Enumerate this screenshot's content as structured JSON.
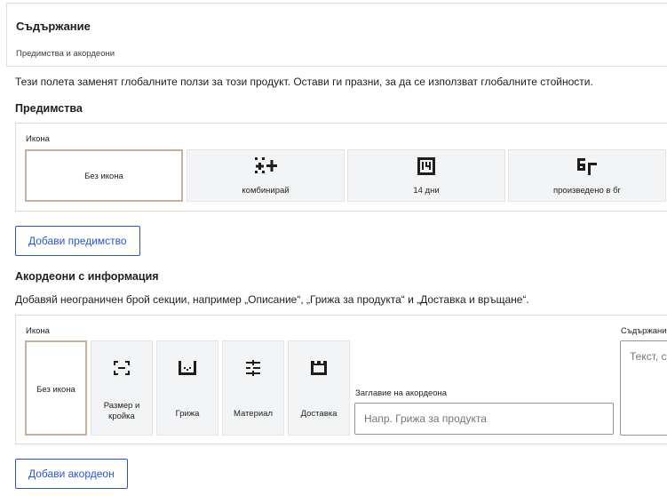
{
  "panel": {
    "title": "Съдържание",
    "subtitle": "Предимства и акордеони"
  },
  "intro": "Тези полета заменят глобалните ползи за този продукт. Остави ги празни, за да се използват глобалните стойности.",
  "benefits": {
    "title": "Предимства",
    "icon_label": "Икона",
    "options": [
      {
        "label": "Без икона",
        "icon": "none",
        "selected": true
      },
      {
        "label": "комбинирай",
        "icon": "combine-icon",
        "selected": false
      },
      {
        "label": "14 дни",
        "icon": "14-days-icon",
        "selected": false
      },
      {
        "label": "произведено в бг",
        "icon": "made-in-bg-icon",
        "selected": false
      }
    ],
    "add_button": "Добави предимство"
  },
  "accordions": {
    "title": "Акордеони с информация",
    "description": "Добавяй неограничен брой секции, например „Описание“, „Грижа за продукта“ и „Доставка и връщане“.",
    "icon_label": "Икона",
    "options": [
      {
        "label": "Без икона",
        "icon": "none",
        "selected": true
      },
      {
        "label": "Размер и кройка",
        "icon": "size-fit-icon",
        "selected": false
      },
      {
        "label": "Грижа",
        "icon": "care-icon",
        "selected": false
      },
      {
        "label": "Материал",
        "icon": "material-icon",
        "selected": false
      },
      {
        "label": "Доставка",
        "icon": "delivery-icon",
        "selected": false
      }
    ],
    "title_field_label": "Заглавие на акордеона",
    "title_field_placeholder": "Напр. Грижа за продукта",
    "content_label": "Съдържание",
    "content_placeholder": "Текст, с",
    "add_button": "Добави акордеон"
  }
}
